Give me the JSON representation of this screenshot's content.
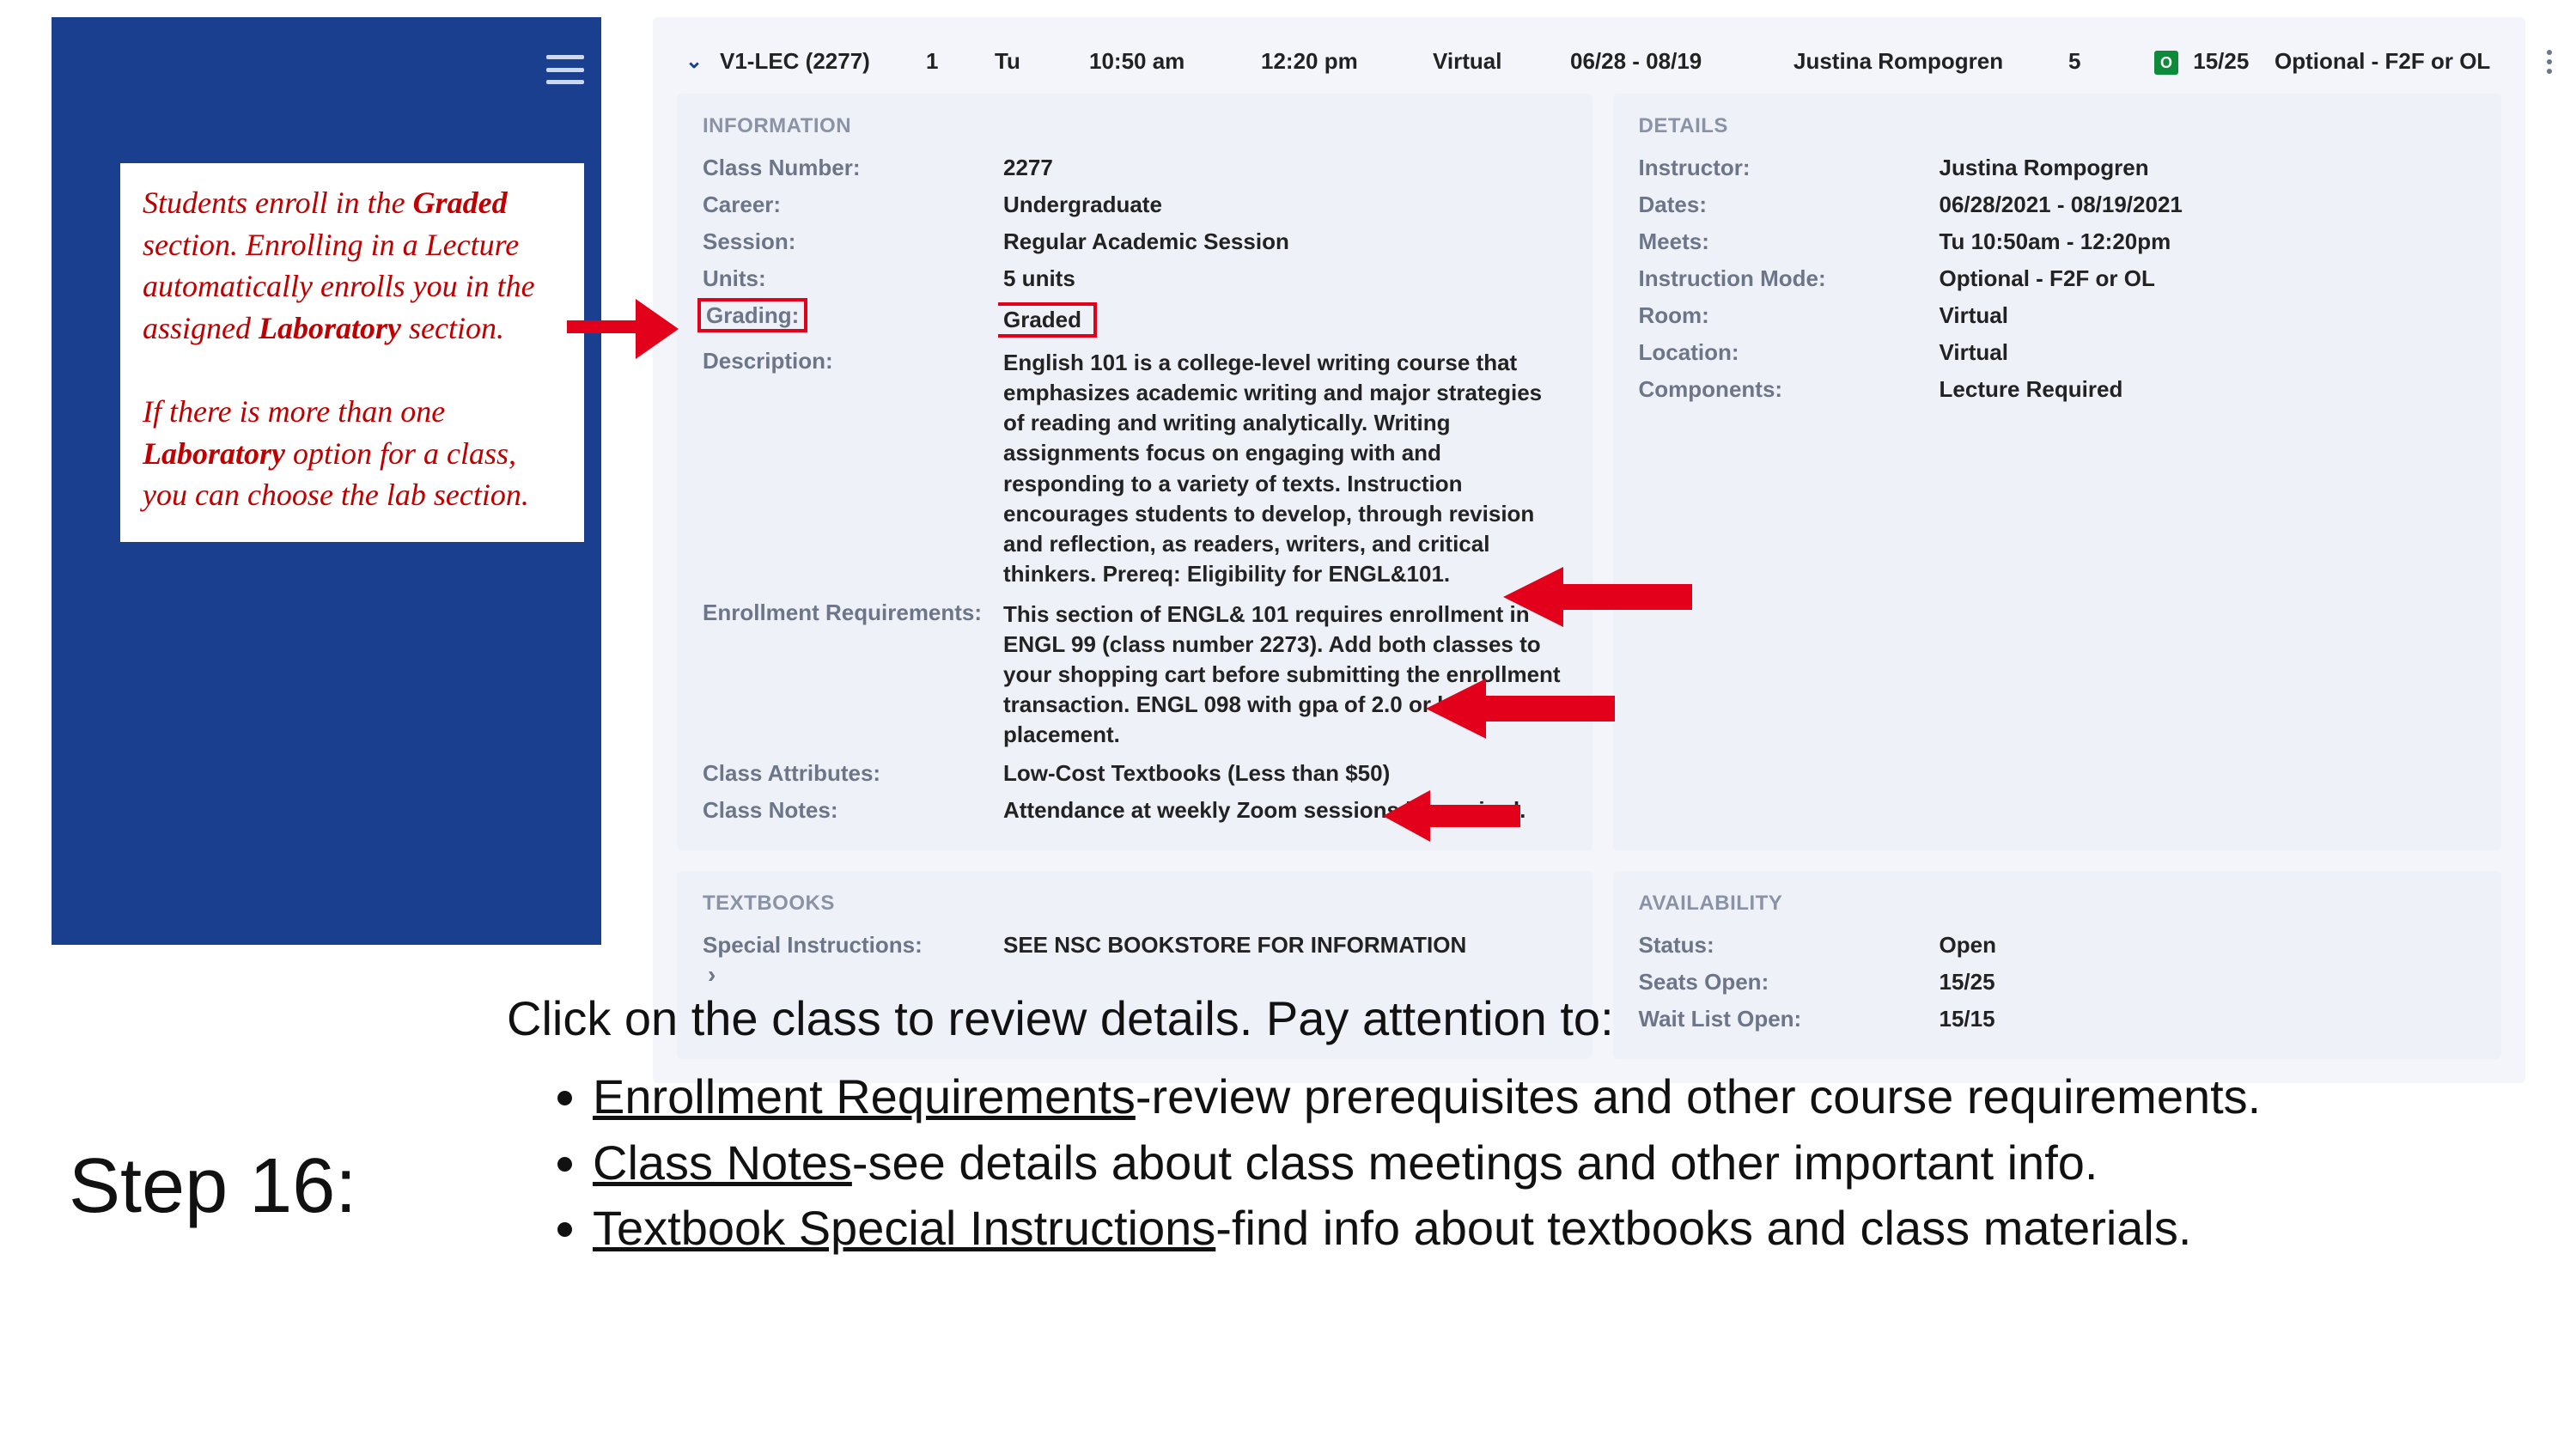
{
  "sidebar": {
    "callout_p1a": "Students enroll in the ",
    "callout_p1b": "Graded",
    "callout_p1c": " section. Enrolling in a Lecture automatically enrolls you in the assigned ",
    "callout_p1d": "Laboratory",
    "callout_p1e": " section.",
    "callout_p2a": "If there is more than one ",
    "callout_p2b": "Laboratory",
    "callout_p2c": " option for a class, you can choose the lab section."
  },
  "class_row": {
    "section": "V1-LEC (2277)",
    "col_num": "1",
    "day": "Tu",
    "start": "10:50 am",
    "end": "12:20 pm",
    "mode": "Virtual",
    "dates": "06/28 - 08/19",
    "instructor": "Justina Rompogren",
    "credits": "5",
    "seats": "15/25",
    "optional": "Optional - F2F or OL"
  },
  "information": {
    "heading": "INFORMATION",
    "class_number_k": "Class Number:",
    "class_number_v": "2277",
    "career_k": "Career:",
    "career_v": "Undergraduate",
    "session_k": "Session:",
    "session_v": "Regular Academic Session",
    "units_k": "Units:",
    "units_v": "5 units",
    "grading_k": "Grading:",
    "grading_v": "Graded",
    "description_k": "Description:",
    "description_v": "English 101 is a college-level writing course that emphasizes academic writing and major strategies of reading and writing analytically. Writing assignments focus on engaging with and responding to a variety of texts. Instruction encourages students to develop, through revision and reflection, as readers, writers, and critical thinkers. Prereq: Eligibility for ENGL&101.",
    "enroll_req_k": "Enrollment Requirements:",
    "enroll_req_v": "This section of ENGL& 101 requires enrollment in ENGL 99 (class number 2273). Add both classes to your shopping cart before submitting the enrollment transaction. ENGL 098 with gpa of 2.0 or higher or placement.",
    "attributes_k": "Class Attributes:",
    "attributes_v": "Low-Cost Textbooks (Less than $50)",
    "notes_k": "Class Notes:",
    "notes_v": "Attendance at weekly Zoom sessions is required."
  },
  "details": {
    "heading": "DETAILS",
    "instructor_k": "Instructor:",
    "instructor_v": "Justina Rompogren",
    "dates_k": "Dates:",
    "dates_v": "06/28/2021 - 08/19/2021",
    "meets_k": "Meets:",
    "meets_v": "Tu 10:50am - 12:20pm",
    "imode_k": "Instruction Mode:",
    "imode_v": "Optional - F2F or OL",
    "room_k": "Room:",
    "room_v": "Virtual",
    "location_k": "Location:",
    "location_v": "Virtual",
    "components_k": "Components:",
    "components_v": "Lecture Required"
  },
  "textbooks": {
    "heading": "TEXTBOOKS",
    "special_k": "Special Instructions:",
    "special_v": "SEE NSC BOOKSTORE FOR INFORMATION"
  },
  "availability": {
    "heading": "AVAILABILITY",
    "status_k": "Status:",
    "status_v": "Open",
    "seats_k": "Seats Open:",
    "seats_v": "15/25",
    "wait_k": "Wait List Open:",
    "wait_v": "15/15"
  },
  "step": {
    "label": "Step 16:",
    "lead": "Click on the class to review details. Pay attention to:",
    "b1a": "Enrollment Requirements",
    "b1b": "-review prerequisites and other course requirements.",
    "b2a": "Class Notes",
    "b2b": "-see details about class meetings and other important info.",
    "b3a": "Textbook Special Instructions",
    "b3b": "-find info about textbooks and class materials."
  },
  "badge": {
    "letter": "O"
  }
}
